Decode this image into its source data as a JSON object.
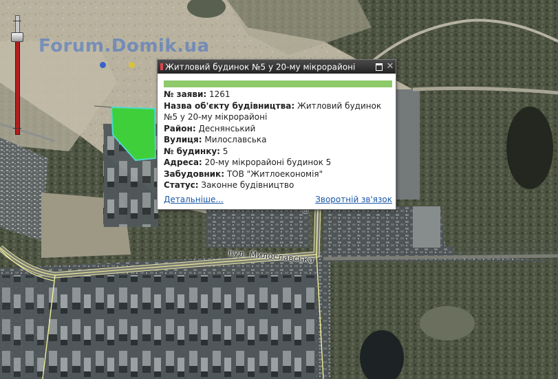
{
  "map": {
    "watermark": "Forum.Domik.ua",
    "watermark_dots": [
      "#3a62c8",
      "#d8c23a",
      "#3a62c8"
    ],
    "street_main": "вул. Милославська",
    "street_side": "вул.",
    "zoom_fraction": 0.82,
    "plot_color": "#3fcf3a"
  },
  "popup": {
    "title": "Житловий будинок №5 у 20-му мікрорайоні",
    "progress_fraction": 1.0,
    "progress_color": "#8ec96a",
    "fields": [
      {
        "label": "№ заяви:",
        "value": " 1261"
      },
      {
        "label": "Назва об'єкту будівництва:",
        "value": " Житловий будинок №5 у 20-му мікрорайоні"
      },
      {
        "label": "Район:",
        "value": " Деснянський"
      },
      {
        "label": "Вулиця:",
        "value": " Милославська"
      },
      {
        "label": "№ будинку:",
        "value": " 5"
      },
      {
        "label": "Адреса:",
        "value": " 20-му мікрорайоні будинок 5"
      },
      {
        "label": "Забудовник:",
        "value": " ТОВ \"Житлоекономія\""
      },
      {
        "label": "Статус:",
        "value": " Законне будівництво"
      }
    ],
    "link_details": "Детальніше...",
    "link_feedback": "Зворотній зв'язок"
  },
  "icons": {
    "maximize": "maximize-icon",
    "close": "close-icon",
    "title": "marker-icon"
  }
}
